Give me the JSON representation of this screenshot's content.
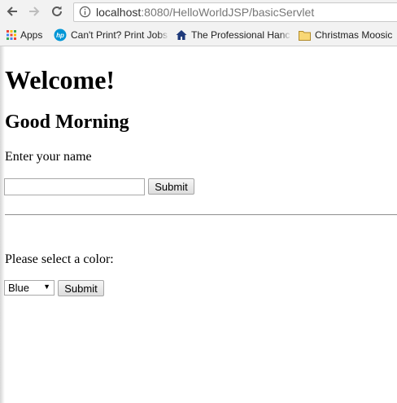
{
  "browser": {
    "url_host": "localhost",
    "url_rest": ":8080/HelloWorldJSP/basicServlet",
    "bookmarks": [
      {
        "label": "Apps",
        "icon": "apps-grid-icon"
      },
      {
        "label": "Can't Print? Print Jobs",
        "icon": "hp-logo-icon"
      },
      {
        "label": "The Professional Hanc",
        "icon": "house-icon"
      },
      {
        "label": "Christmas Moosic",
        "icon": "folder-icon"
      }
    ]
  },
  "page": {
    "heading": "Welcome!",
    "greeting": "Good Morning",
    "name_prompt": "Enter your name",
    "name_value": "",
    "name_submit": "Submit",
    "color_prompt": "Please select a color:",
    "color_selected": "Blue",
    "color_submit": "Submit"
  }
}
